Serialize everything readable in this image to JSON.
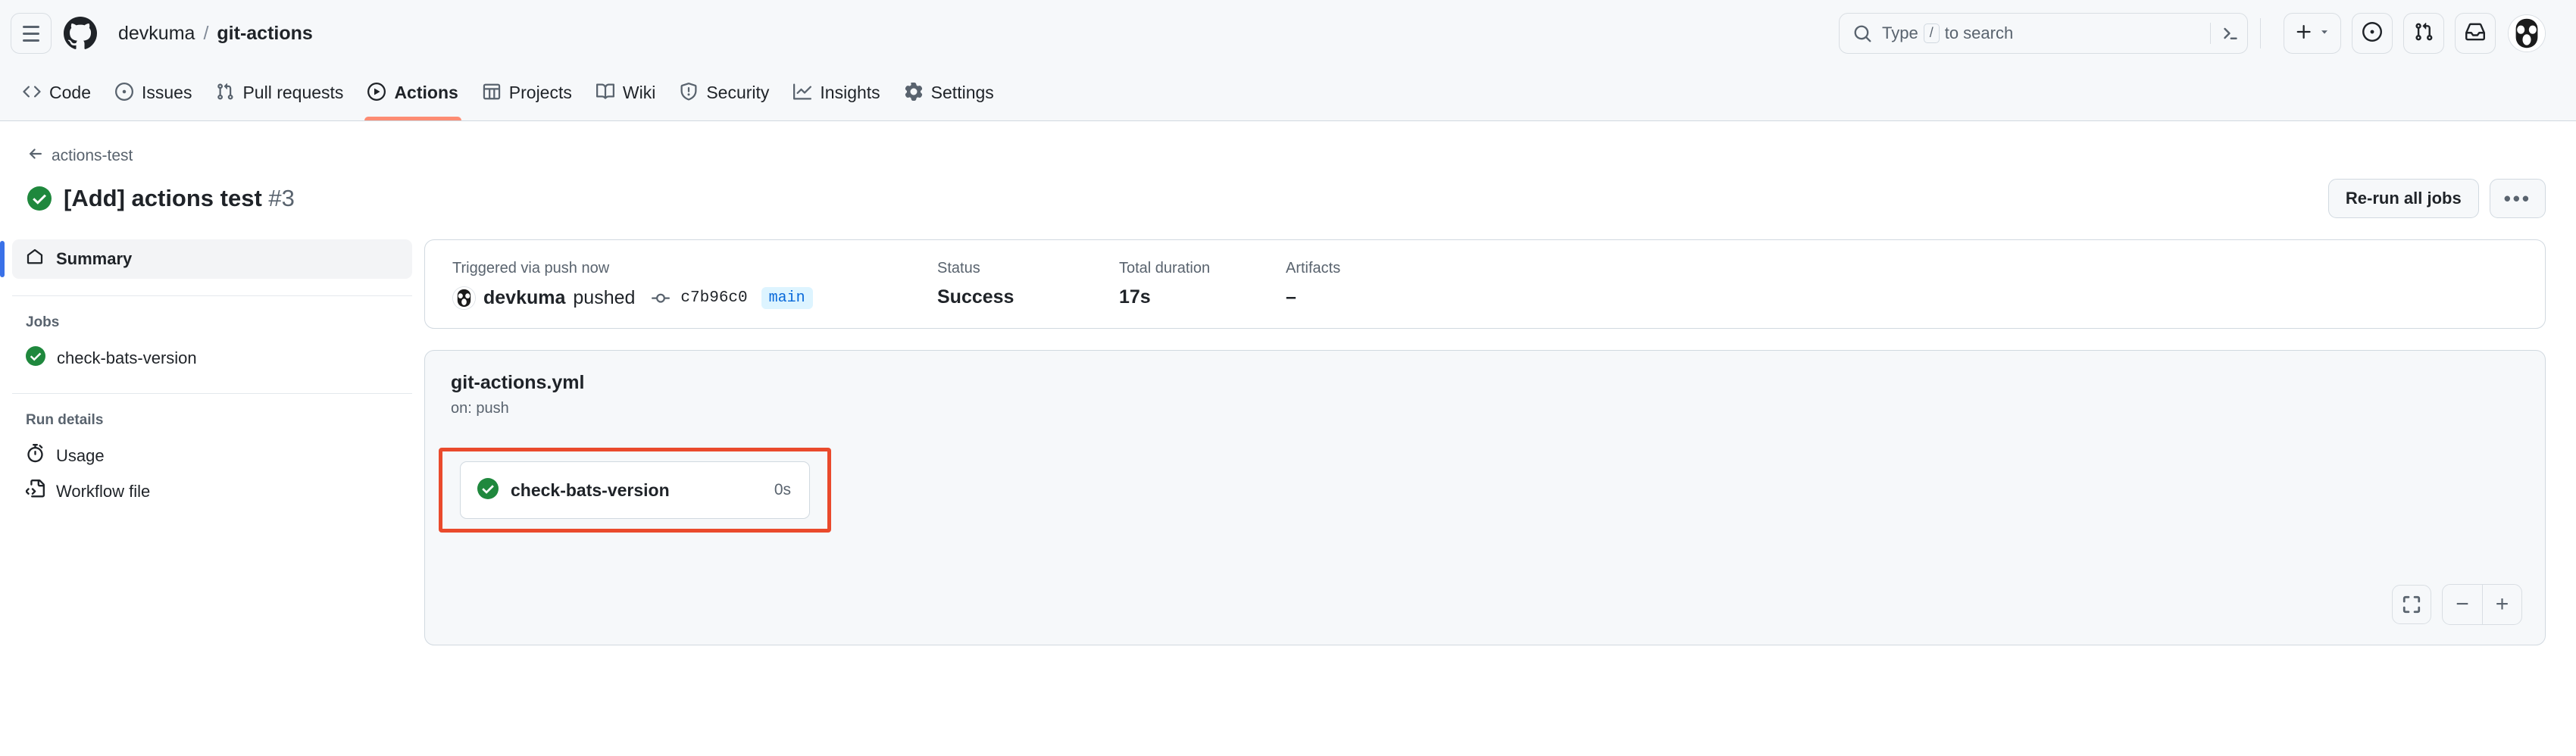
{
  "header": {
    "menu_icon": "hamburger-icon",
    "logo_icon": "github-logo-icon",
    "owner": "devkuma",
    "separator": "/",
    "repo": "git-actions",
    "search": {
      "icon": "search-icon",
      "placeholder_prefix": "Type",
      "slash_key": "/",
      "placeholder_suffix": "to search",
      "terminal_icon": "command-palette-icon"
    },
    "create_button": {
      "icon": "plus-icon",
      "caret": "chevron-down-icon"
    },
    "issues_icon": "issue-opened-icon",
    "pulls_icon": "git-pull-request-icon",
    "inbox_icon": "inbox-icon",
    "avatar": "user-avatar"
  },
  "repo_nav": {
    "items": [
      {
        "label": "Code",
        "icon": "code-icon",
        "active": false
      },
      {
        "label": "Issues",
        "icon": "issue-opened-icon",
        "active": false
      },
      {
        "label": "Pull requests",
        "icon": "git-pull-request-icon",
        "active": false
      },
      {
        "label": "Actions",
        "icon": "play-icon",
        "active": true
      },
      {
        "label": "Projects",
        "icon": "table-icon",
        "active": false
      },
      {
        "label": "Wiki",
        "icon": "book-icon",
        "active": false
      },
      {
        "label": "Security",
        "icon": "shield-icon",
        "active": false
      },
      {
        "label": "Insights",
        "icon": "graph-icon",
        "active": false
      },
      {
        "label": "Settings",
        "icon": "gear-icon",
        "active": false
      }
    ],
    "active_underline_color": "#fd8c73"
  },
  "page": {
    "back_label": "actions-test",
    "back_icon": "arrow-left-icon",
    "status_icon": "check-circle-success-icon",
    "run_title": "[Add] actions test",
    "run_number": "#3",
    "rerun_button": "Re-run all jobs",
    "more_button": "•••"
  },
  "sidebar": {
    "summary": {
      "label": "Summary",
      "icon": "home-icon"
    },
    "jobs_heading": "Jobs",
    "jobs": [
      {
        "label": "check-bats-version",
        "icon": "check-circle-success-icon"
      }
    ],
    "run_details_heading": "Run details",
    "run_details": [
      {
        "label": "Usage",
        "icon": "stopwatch-icon"
      },
      {
        "label": "Workflow file",
        "icon": "file-code-icon"
      }
    ]
  },
  "summary_card": {
    "trigger": {
      "label": "Triggered via push now",
      "avatar": "devkuma-avatar",
      "actor": "devkuma",
      "action": "pushed",
      "commit_icon": "git-commit-icon",
      "commit_sha": "c7b96c0",
      "branch": "main"
    },
    "status": {
      "label": "Status",
      "value": "Success"
    },
    "duration": {
      "label": "Total duration",
      "value": "17s"
    },
    "artifacts": {
      "label": "Artifacts",
      "value": "–"
    }
  },
  "graph": {
    "workflow_file": "git-actions.yml",
    "trigger_line": "on: push",
    "job_node": {
      "status_icon": "check-circle-success-icon",
      "label": "check-bats-version",
      "duration": "0s"
    },
    "annotation_color": "#ea4a2c",
    "controls": {
      "fit_icon": "fit-to-screen-icon",
      "zoom_out": "−",
      "zoom_in": "+"
    }
  }
}
